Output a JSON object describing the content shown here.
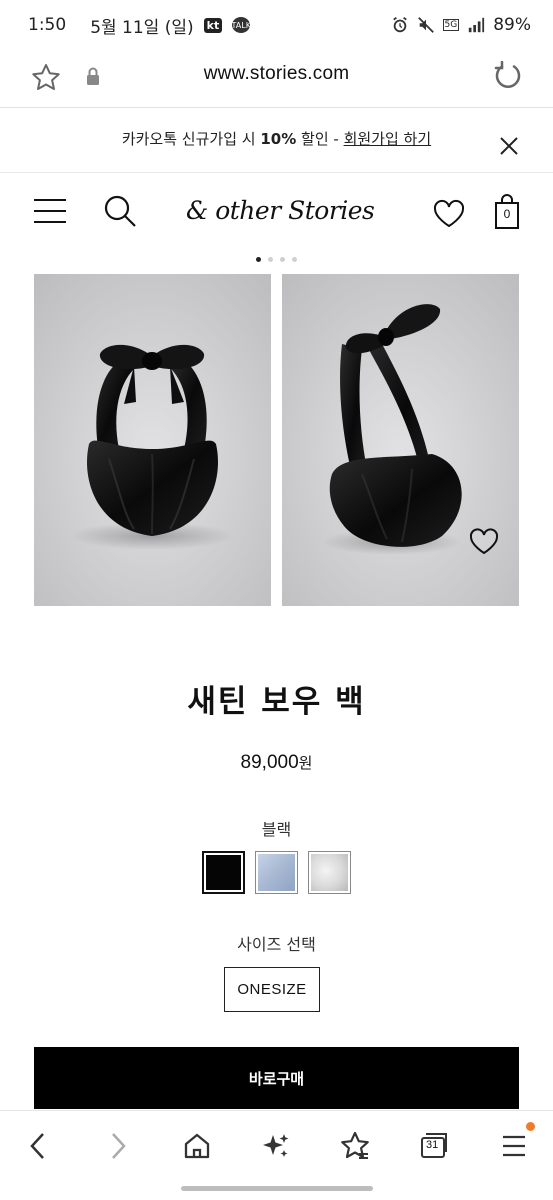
{
  "status_bar": {
    "time": "1:50",
    "date": "5월 11일 (일)",
    "kt_badge": "kt",
    "talk_badge": "TALK",
    "network": "5G",
    "battery": "89%"
  },
  "browser": {
    "url": "www.stories.com"
  },
  "promo": {
    "text_before": "카카오톡 신규가입 시 ",
    "discount": "10%",
    "text_middle": " 할인 - ",
    "link": "회원가입 하기"
  },
  "header": {
    "logo": "& other Stories",
    "bag_count": "0"
  },
  "carousel": {
    "dot_count": 4,
    "active_dot": 0
  },
  "product": {
    "title": "새틴 보우 백",
    "price": "89,000",
    "price_unit": "원",
    "color_label": "블랙",
    "swatches": [
      {
        "name": "black",
        "color": "#050505"
      },
      {
        "name": "light-blue",
        "color": "#a7b8d2"
      },
      {
        "name": "silver",
        "color": "#d9d9d9"
      }
    ],
    "selected_swatch": 0,
    "size_label": "사이즈 선택",
    "size_option": "ONESIZE",
    "buy_label": "바로구매"
  },
  "bottom_nav": {
    "tabs_count": "31"
  }
}
